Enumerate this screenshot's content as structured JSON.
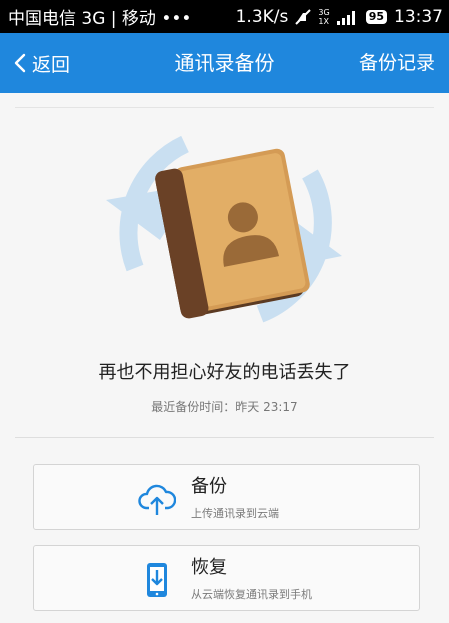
{
  "status_bar": {
    "carrier": "中国电信 3G | 移动 •••",
    "speed": "1.3K/s",
    "signal_labels": [
      "3G",
      "1X"
    ],
    "battery": "95",
    "time": "13:37"
  },
  "header": {
    "back_label": "返回",
    "title": "通讯录备份",
    "records_label": "备份记录"
  },
  "main": {
    "tagline": "再也不用担心好友的电话丢失了",
    "last_backup": "最近备份时间：昨天 23:17"
  },
  "actions": [
    {
      "title": "备份",
      "subtitle": "上传通讯录到云端",
      "icon": "cloud-upload-icon"
    },
    {
      "title": "恢复",
      "subtitle": "从云端恢复通讯录到手机",
      "icon": "phone-download-icon"
    }
  ],
  "colors": {
    "accent": "#1f87dd",
    "status_bar": "#000000",
    "background": "#f6f6f6"
  }
}
